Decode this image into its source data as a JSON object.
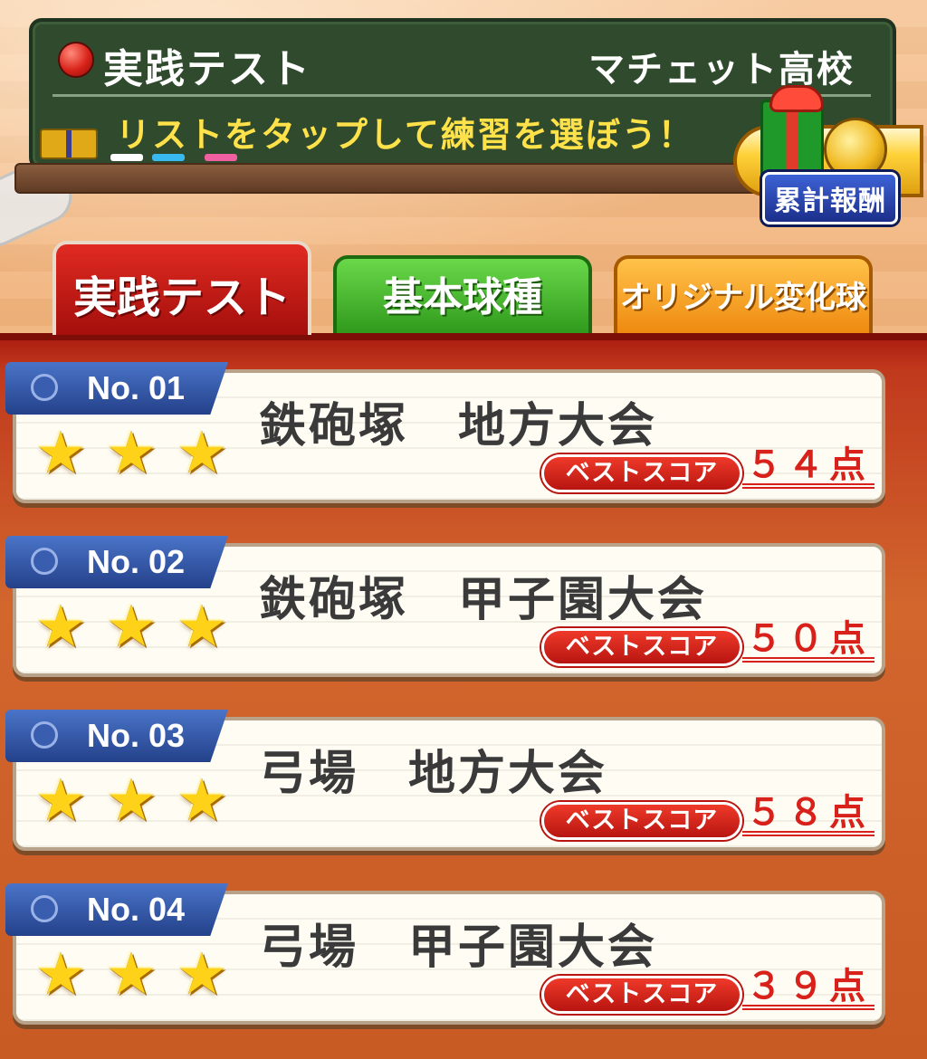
{
  "board": {
    "title": "実践テスト",
    "school": "マチェット高校",
    "hint": "リストをタップして練習を選ぼう！"
  },
  "reward": {
    "label": "累計報酬"
  },
  "tabs": [
    {
      "label": "実践テスト",
      "active": true
    },
    {
      "label": "基本球種",
      "active": false
    },
    {
      "label": "オリジナル変化球",
      "active": false
    }
  ],
  "items": [
    {
      "no": "No. 01",
      "title": "鉄砲塚　地方大会",
      "best_label": "ベストスコア",
      "score": "５４点",
      "stars": 3
    },
    {
      "no": "No. 02",
      "title": "鉄砲塚　甲子園大会",
      "best_label": "ベストスコア",
      "score": "５０点",
      "stars": 3
    },
    {
      "no": "No. 03",
      "title": "弓場　地方大会",
      "best_label": "ベストスコア",
      "score": "５８点",
      "stars": 3
    },
    {
      "no": "No. 04",
      "title": "弓場　甲子園大会",
      "best_label": "ベストスコア",
      "score": "３９点",
      "stars": 3
    }
  ],
  "colors": {
    "board": "#2f4a2c",
    "hint": "#ffe14a",
    "tab_active": "#d9221c",
    "tab_green": "#3fb22a",
    "tab_orange": "#f5a020",
    "score": "#d8211a"
  }
}
